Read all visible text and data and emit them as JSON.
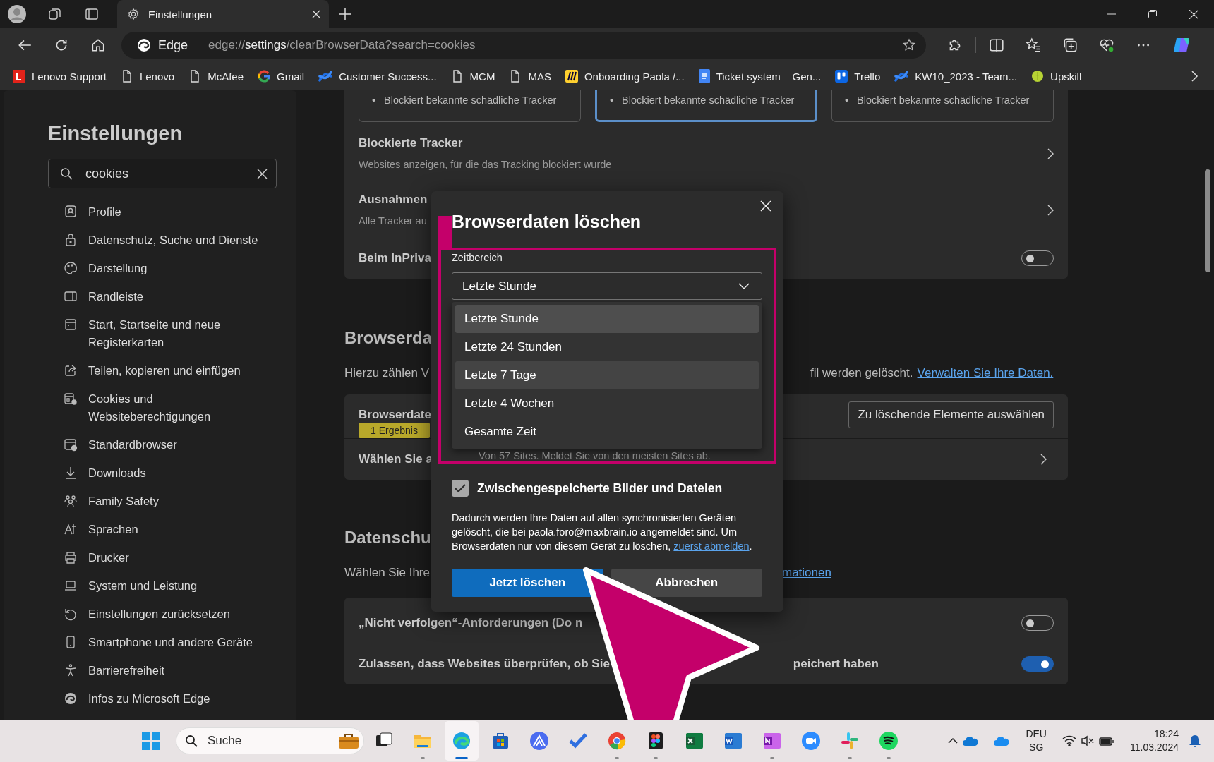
{
  "tabs": [
    {
      "title": "Einstellungen",
      "selected": true
    }
  ],
  "address_bar": {
    "site_label": "Edge",
    "url_scheme": "edge://",
    "url_host": "settings",
    "url_path": "/clearBrowserData?search=cookies"
  },
  "bookmarks": [
    {
      "label": "Lenovo Support",
      "kind": "square"
    },
    {
      "label": "Lenovo",
      "kind": "page"
    },
    {
      "label": "McAfee",
      "kind": "page"
    },
    {
      "label": "Gmail",
      "kind": "ring"
    },
    {
      "label": "Customer Success...",
      "kind": "cross"
    },
    {
      "label": "MCM",
      "kind": "page"
    },
    {
      "label": "MAS",
      "kind": "page"
    },
    {
      "label": "Onboarding Paola /...",
      "kind": "striped"
    },
    {
      "label": "Ticket system – Gen...",
      "kind": "doc"
    },
    {
      "label": "Trello",
      "kind": "board"
    },
    {
      "label": "KW10_2023 - Team...",
      "kind": "cross"
    },
    {
      "label": "Upskill",
      "kind": "leaf"
    }
  ],
  "sidebar": {
    "title": "Einstellungen",
    "search": {
      "value": "cookies"
    },
    "items": [
      {
        "label": "Profile",
        "kind": "profile"
      },
      {
        "label": "Datenschutz, Suche und Dienste",
        "kind": "lock"
      },
      {
        "label": "Darstellung",
        "kind": "palette"
      },
      {
        "label": "Randleiste",
        "kind": "panel"
      },
      {
        "label": "Start, Startseite und neue Registerkarten",
        "kind": "start"
      },
      {
        "label": "Teilen, kopieren und einfügen",
        "kind": "share"
      },
      {
        "label": "Cookies und Websiteberechtigungen",
        "kind": "cookies"
      },
      {
        "label": "Standardbrowser",
        "kind": "browser"
      },
      {
        "label": "Downloads",
        "kind": "download"
      },
      {
        "label": "Family Safety",
        "kind": "family"
      },
      {
        "label": "Sprachen",
        "kind": "language"
      },
      {
        "label": "Drucker",
        "kind": "printer"
      },
      {
        "label": "System und Leistung",
        "kind": "laptop"
      },
      {
        "label": "Einstellungen zurücksetzen",
        "kind": "reset"
      },
      {
        "label": "Smartphone und andere Geräte",
        "kind": "phone"
      },
      {
        "label": "Barrierefreiheit",
        "kind": "accessibility"
      },
      {
        "label": "Infos zu Microsoft Edge",
        "kind": "edge"
      }
    ]
  },
  "main": {
    "tracker_cards": [
      {
        "marker": "•",
        "bullet": "Blockiert bekannte schädliche Tracker",
        "selected": false
      },
      {
        "marker": "•",
        "bullet": "Blockiert bekannte schädliche Tracker",
        "selected": true
      },
      {
        "marker": "•",
        "bullet": "Blockiert bekannte schädliche Tracker",
        "selected": false
      }
    ],
    "tracker_rows": [
      {
        "title": "Blockierte Tracker",
        "subtitle": "Websites anzeigen, für die das Tracking blockiert wurde"
      },
      {
        "title": "Ausnahmen",
        "subtitle": "Alle Tracker au"
      }
    ],
    "inprivate_row": {
      "title": "Beim InPriva",
      "on": false
    },
    "browser_data": {
      "heading": "Browserda",
      "intro_start": "Hierzu zählen V",
      "intro_end": "fil werden gelöscht.",
      "intro_link": "Verwalten Sie Ihre Daten.",
      "row_title": "Browserdate",
      "badge": "1 Ergebnis",
      "choose_button": "Zu löschende Elemente auswählen",
      "row2_title": "Wählen Sie a"
    },
    "privacy": {
      "heading": "Datenschu",
      "intro_start": "Wählen Sie Ihre",
      "intro_link": "mationen",
      "toggles": [
        {
          "label": "„Nicht verfolgen“-Anforderungen (Do n",
          "on": false
        },
        {
          "label": "Zulassen, dass Websites überprüfen, ob Sie",
          "label_end": "peichert haben",
          "on": true
        }
      ]
    }
  },
  "dialog": {
    "title": "Browserdaten löschen",
    "time_range_label": "Zeitbereich",
    "time_range_value": "Letzte Stunde",
    "expanded": true,
    "options": [
      {
        "label": "Letzte Stunde",
        "selected": true,
        "hovered": false
      },
      {
        "label": "Letzte 24 Stunden",
        "selected": false,
        "hovered": false
      },
      {
        "label": "Letzte 7 Tage",
        "selected": false,
        "hovered": true
      },
      {
        "label": "Letzte 4 Wochen",
        "selected": false,
        "hovered": false
      },
      {
        "label": "Gesamte Zeit",
        "selected": false,
        "hovered": false
      }
    ],
    "hint": "Von 57 Sites. Meldet Sie von den meisten Sites ab.",
    "checkbox": {
      "label": "Zwischengespeicherte Bilder und Dateien",
      "checked": true
    },
    "notice": "Dadurch werden Ihre Daten auf allen synchronisierten Geräten gelöscht, die bei paola.foro@maxbrain.io angemeldet sind. Um Browserdaten nur von diesem Gerät zu löschen,",
    "notice_link": "zuerst abmelden",
    "notice_end": ".",
    "buttons": [
      "Jetzt löschen",
      "Abbrechen"
    ]
  },
  "taskbar": {
    "search_placeholder": "Suche",
    "apps": [
      {
        "kind": "taskview",
        "running": false,
        "active": false
      },
      {
        "kind": "folder",
        "running": true,
        "active": false
      },
      {
        "kind": "edge",
        "running": true,
        "active": true
      },
      {
        "kind": "store",
        "running": false,
        "active": false
      },
      {
        "kind": "peak",
        "running": false,
        "active": false
      },
      {
        "kind": "check",
        "running": false,
        "active": false
      },
      {
        "kind": "chrome",
        "running": true,
        "active": false
      },
      {
        "kind": "dots",
        "running": true,
        "active": false
      },
      {
        "kind": "sheet",
        "running": false,
        "active": false
      },
      {
        "kind": "doc",
        "running": false,
        "active": false
      },
      {
        "kind": "note",
        "running": true,
        "active": false
      },
      {
        "kind": "video",
        "running": false,
        "active": false
      },
      {
        "kind": "hash",
        "running": true,
        "active": false
      },
      {
        "kind": "music",
        "running": true,
        "active": false
      }
    ],
    "language": "DEU",
    "layout": "SG",
    "time": "18:24",
    "date": "11.03.2024"
  }
}
